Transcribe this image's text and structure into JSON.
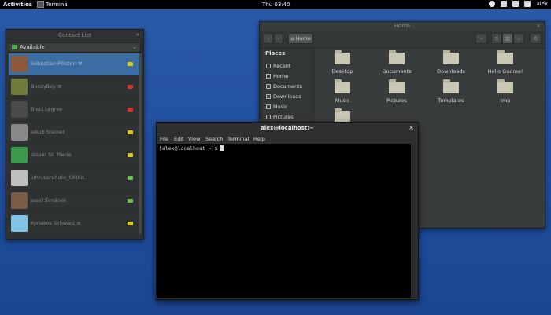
{
  "topbar": {
    "activities": "Activities",
    "app": "Terminal",
    "clock": "Thu 03:40",
    "user": "alex"
  },
  "contacts": {
    "title": "Contact List",
    "status": "Available",
    "items": [
      {
        "name": "Sebastian Pölsterl ✉",
        "status_color": "#d6c61e",
        "avatar_color": "#8b5a3c",
        "selected": true
      },
      {
        "name": "BoozyBoy ✉",
        "status_color": "#d9322e",
        "avatar_color": "#6e7b3a"
      },
      {
        "name": "Brett Legree",
        "status_color": "#d9322e",
        "avatar_color": "#4a4a4a"
      },
      {
        "name": "Jakub Steiner",
        "status_color": "#d6c61e",
        "avatar_color": "#888"
      },
      {
        "name": "Jasper St. Pierre",
        "status_color": "#d6c61e",
        "avatar_color": "#3c9a4d"
      },
      {
        "name": "john.karahalis_GMAIL",
        "status_color": "#6cc04a",
        "avatar_color": "#bfbfbf"
      },
      {
        "name": "Josef Šimánek",
        "status_color": "#6cc04a",
        "avatar_color": "#7a5c46"
      },
      {
        "name": "Kyriakos Schwarz ✉",
        "status_color": "#d6c61e",
        "avatar_color": "#7fc3e6"
      }
    ]
  },
  "files": {
    "title": "Home",
    "path_button": "Home",
    "places_header": "Places",
    "places": [
      "Recent",
      "Home",
      "Documents",
      "Downloads",
      "Music",
      "Pictures"
    ],
    "items": [
      "Desktop",
      "Documents",
      "Downloads",
      "Hello Gnome!",
      "Music",
      "Pictures",
      "Templates",
      "tmp"
    ]
  },
  "terminal": {
    "title": "alex@localhost:~",
    "menu": [
      "File",
      "Edit",
      "View",
      "Search",
      "Terminal",
      "Help"
    ],
    "prompt": "[alex@localhost ~]$ "
  }
}
